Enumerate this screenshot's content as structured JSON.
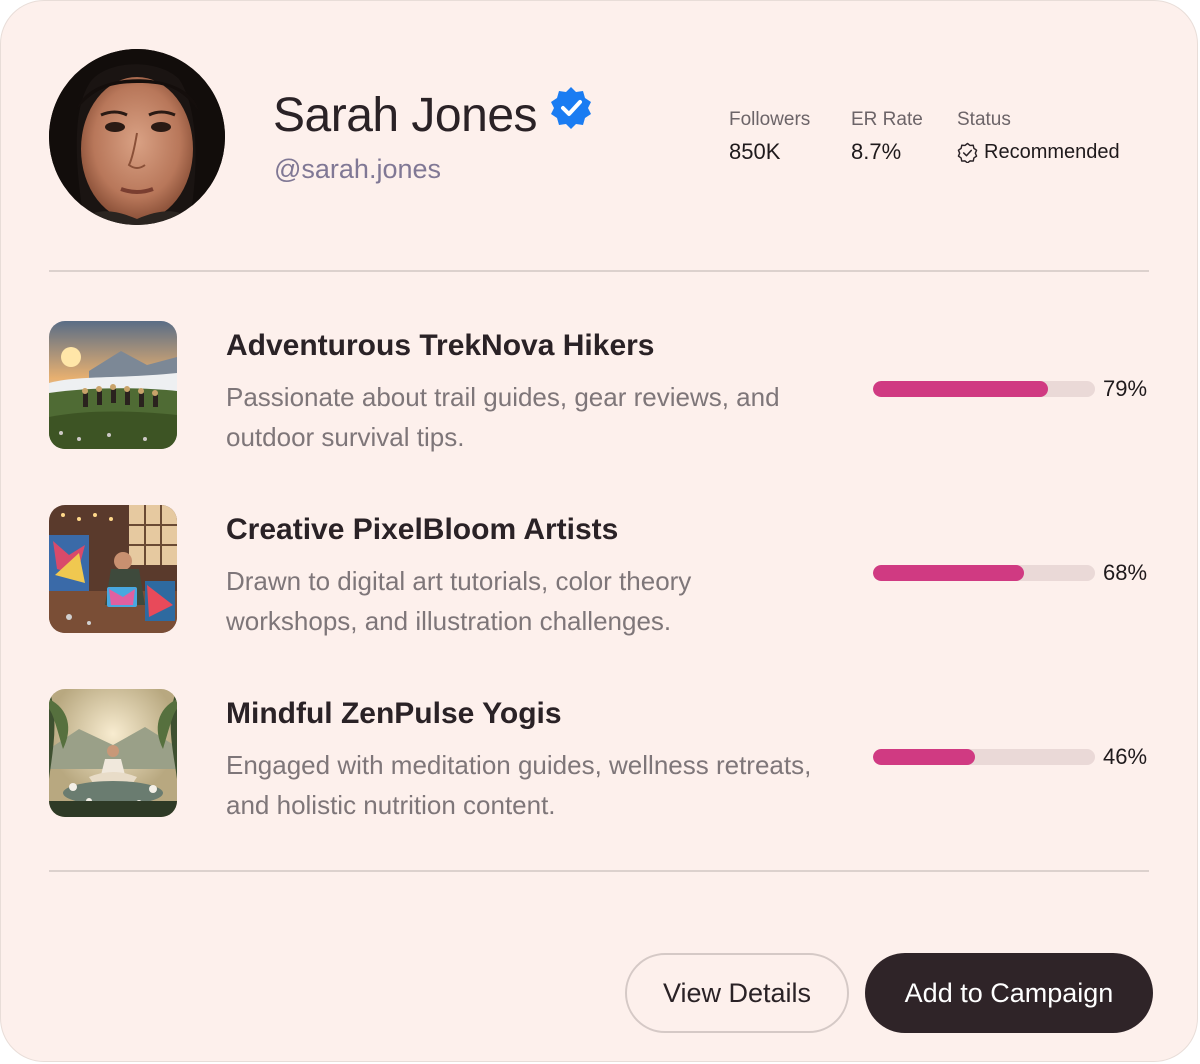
{
  "profile": {
    "name": "Sarah Jones",
    "handle": "@sarah.jones",
    "verified_icon": "verified-badge-icon",
    "verified_color": "#1a7cf2"
  },
  "stats": {
    "followers_label": "Followers",
    "followers_value": "850K",
    "er_label": "ER Rate",
    "er_value": "8.7%",
    "status_label": "Status",
    "status_value": "Recommended",
    "status_icon": "badge-check-icon"
  },
  "audiences": [
    {
      "title": "Adventurous TrekNova Hikers",
      "description": "Passionate about trail guides, gear reviews, and outdoor survival tips.",
      "percent_label": "79%",
      "percent": 79,
      "thumbnail_icon": "mountain-hikers-image"
    },
    {
      "title": "Creative PixelBloom Artists",
      "description": "Drawn to digital art tutorials, color theory workshops, and illustration challenges.",
      "percent_label": "68%",
      "percent": 68,
      "thumbnail_icon": "artist-studio-image"
    },
    {
      "title": "Mindful ZenPulse Yogis",
      "description": "Engaged with meditation guides, wellness retreats, and holistic nutrition content.",
      "percent_label": "46%",
      "percent": 46,
      "thumbnail_icon": "meditation-image"
    }
  ],
  "actions": {
    "secondary_label": "View Details",
    "primary_label": "Add to Campaign"
  },
  "colors": {
    "background": "#fdf0ec",
    "accent": "#d03a82",
    "bar_track": "#ead9d7",
    "primary_button": "#2f2428"
  }
}
